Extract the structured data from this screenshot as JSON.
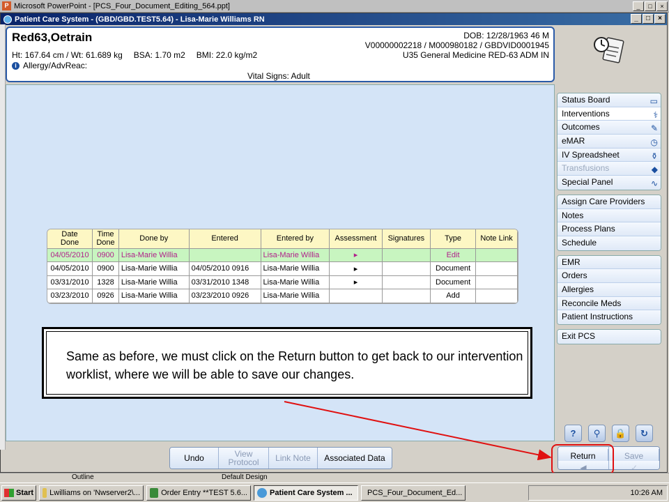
{
  "ppt_window": {
    "title": "Microsoft PowerPoint - [PCS_Four_Document_Editing_564.ppt]",
    "status_outline": "Outline",
    "status_design": "Default Design"
  },
  "pcs_window": {
    "title": "Patient Care System - (GBD/GBD.TEST5.64) - Lisa-Marie Williams RN"
  },
  "patient": {
    "name": "Red63,Oetrain",
    "height_weight": "Ht: 167.64 cm / Wt: 61.689 kg",
    "bsa": "BSA: 1.70 m2",
    "bmi": "BMI: 22.0 kg/m2",
    "allergy": "Allergy/AdvReac:",
    "dob": "DOB: 12/28/1963 46 M",
    "ids": "V00000002218 / M000980182 / GBDVID0001945",
    "unit": "U35 General Medicine  RED-63  ADM IN",
    "vitals_type": "Vital Signs: Adult"
  },
  "grid": {
    "headers": [
      "Date\nDone",
      "Time\nDone",
      "Done by",
      "Entered",
      "Entered by",
      "Assessment",
      "Signatures",
      "Type",
      "Note Link"
    ],
    "rows": [
      [
        "04/05/2010",
        "0900",
        "Lisa-Marie Willia",
        "",
        "Lisa-Marie Willia",
        "▸",
        "",
        "Edit",
        ""
      ],
      [
        "04/05/2010",
        "0900",
        "Lisa-Marie Willia",
        "04/05/2010 0916",
        "Lisa-Marie Willia",
        "▸",
        "",
        "Document",
        ""
      ],
      [
        "03/31/2010",
        "1328",
        "Lisa-Marie Willia",
        "03/31/2010 1348",
        "Lisa-Marie Willia",
        "▸",
        "",
        "Document",
        ""
      ],
      [
        "03/23/2010",
        "0926",
        "Lisa-Marie Willia",
        "03/23/2010 0926",
        "Lisa-Marie Willia",
        "",
        "",
        "Add",
        ""
      ]
    ]
  },
  "callout": {
    "text": "Same as before, we must click on the Return button to get back to our intervention worklist, where we will be able to save our changes."
  },
  "sidebar": {
    "group1": [
      {
        "label": "Status Board",
        "icon": "book-icon"
      },
      {
        "label": "Interventions",
        "icon": "stethoscope-icon"
      },
      {
        "label": "Outcomes",
        "icon": "check-pencil-icon"
      },
      {
        "label": "eMAR",
        "icon": "clock-med-icon"
      },
      {
        "label": "IV Spreadsheet",
        "icon": "iv-bag-icon"
      },
      {
        "label": "Transfusions",
        "icon": "blood-icon"
      },
      {
        "label": "Special Panel",
        "icon": "pulse-icon"
      }
    ],
    "group2": [
      {
        "label": "Assign Care Providers"
      },
      {
        "label": "Notes"
      },
      {
        "label": "Process Plans"
      },
      {
        "label": "Schedule"
      }
    ],
    "group3": [
      {
        "label": "EMR"
      },
      {
        "label": "Orders"
      },
      {
        "label": "Allergies"
      },
      {
        "label": "Reconcile Meds"
      },
      {
        "label": "Patient Instructions"
      }
    ],
    "exit": "Exit PCS"
  },
  "bottom_buttons": {
    "undo": "Undo",
    "view_protocol": "View Protocol",
    "link_note": "Link Note",
    "associated_data": "Associated Data",
    "return": "Return",
    "save": "Save"
  },
  "taskbar": {
    "start": "Start",
    "tasks": [
      "Lwilliams on 'Nwserver2\\...",
      "Order Entry **TEST 5.6...",
      "Patient Care System ...",
      "PCS_Four_Document_Ed..."
    ],
    "clock": "10:26 AM"
  }
}
